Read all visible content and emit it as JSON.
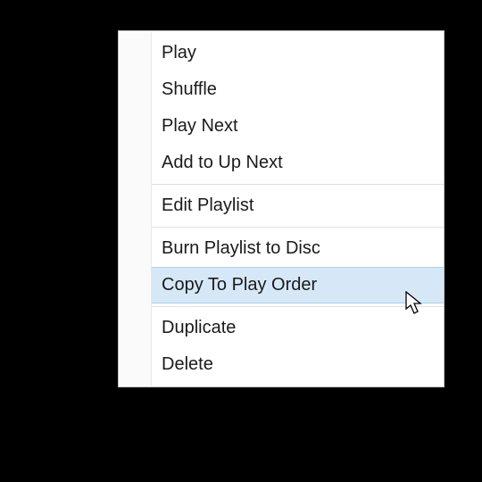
{
  "menu": {
    "groups": [
      [
        {
          "label": "Play",
          "name": "menu-item-play",
          "hover": false
        },
        {
          "label": "Shuffle",
          "name": "menu-item-shuffle",
          "hover": false
        },
        {
          "label": "Play Next",
          "name": "menu-item-play-next",
          "hover": false
        },
        {
          "label": "Add to Up Next",
          "name": "menu-item-add-to-up-next",
          "hover": false
        }
      ],
      [
        {
          "label": "Edit Playlist",
          "name": "menu-item-edit-playlist",
          "hover": false
        }
      ],
      [
        {
          "label": "Burn Playlist to Disc",
          "name": "menu-item-burn-playlist-to-disc",
          "hover": false
        },
        {
          "label": "Copy To Play Order",
          "name": "menu-item-copy-to-play-order",
          "hover": true
        }
      ],
      [
        {
          "label": "Duplicate",
          "name": "menu-item-duplicate",
          "hover": false
        },
        {
          "label": "Delete",
          "name": "menu-item-delete",
          "hover": false
        }
      ]
    ]
  }
}
